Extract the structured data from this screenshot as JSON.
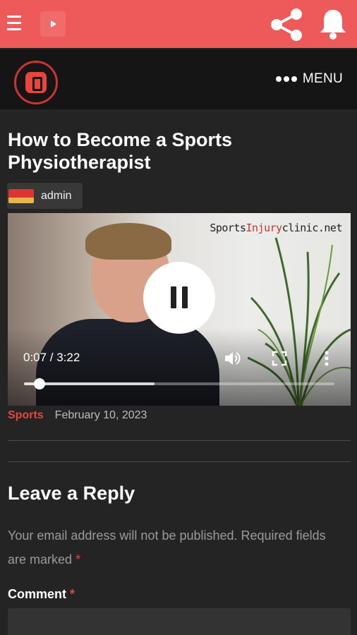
{
  "colors": {
    "appbar": "#ee5a5a",
    "accent": "#e8453c",
    "background": "#242424",
    "sitebar": "#151515"
  },
  "appbar": {
    "menu_icon": "hamburger-icon",
    "logo_icon": "play-icon",
    "share_icon": "share-icon",
    "bell_icon": "bell-icon"
  },
  "site": {
    "menu_label": "MENU"
  },
  "post": {
    "title": "How to Become a Sports Physiotherapist",
    "author": "admin",
    "category": "Sports",
    "date": "February 10, 2023"
  },
  "video": {
    "watermark_prefix": "Sports",
    "watermark_highlight": "Injury",
    "watermark_suffix": "clinic.net",
    "time": "0:07 / 3:22",
    "played_fraction": 0.05,
    "buffered_fraction": 0.42,
    "state": "playing"
  },
  "reply": {
    "title": "Leave a Reply",
    "notes": "Your email address will not be published. Required fields are marked",
    "required_mark": "*",
    "comment_label": "Comment"
  }
}
